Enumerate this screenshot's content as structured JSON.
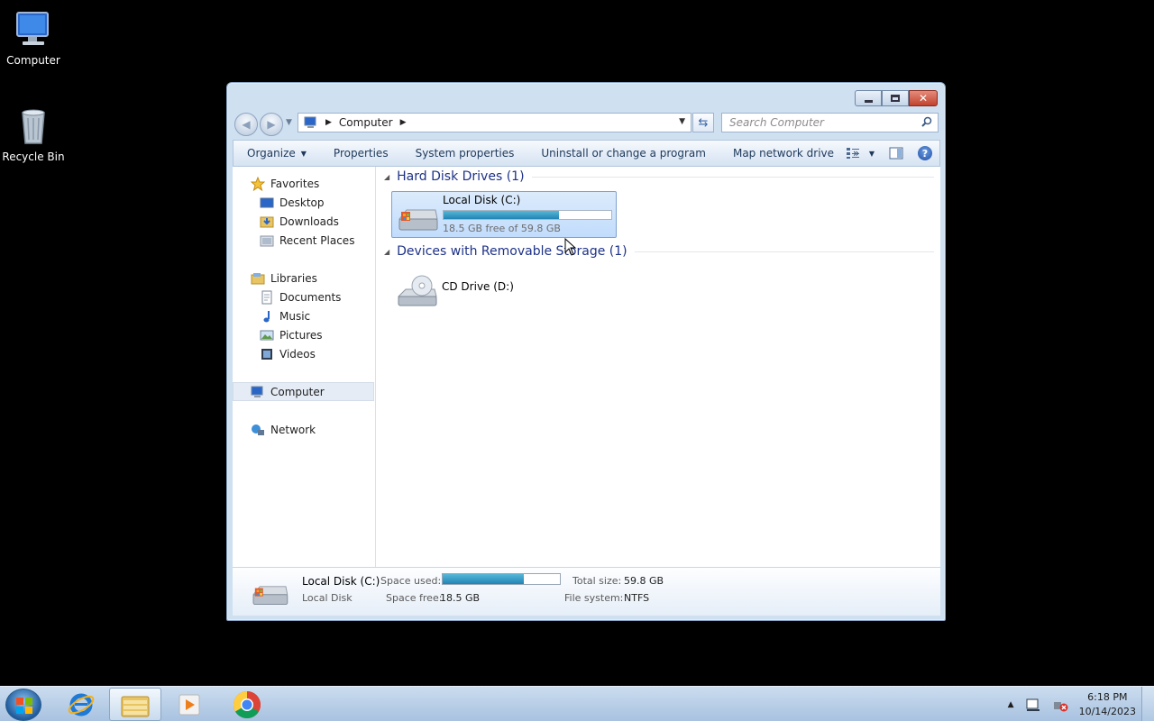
{
  "desktop": {
    "icons": [
      {
        "label": "Computer",
        "icon": "computer-icon"
      },
      {
        "label": "Recycle Bin",
        "icon": "recycle-bin-icon"
      }
    ]
  },
  "window": {
    "title": "",
    "nav": {
      "address_crumb": "Computer",
      "search_placeholder": "Search Computer"
    },
    "command_bar": {
      "organize": "Organize",
      "properties": "Properties",
      "system_properties": "System properties",
      "uninstall": "Uninstall or change a program",
      "map_drive": "Map network drive",
      "more": "»"
    },
    "nav_pane": {
      "favorites": "Favorites",
      "desktop": "Desktop",
      "downloads": "Downloads",
      "recent_places": "Recent Places",
      "libraries": "Libraries",
      "documents": "Documents",
      "music": "Music",
      "pictures": "Pictures",
      "videos": "Videos",
      "computer": "Computer",
      "network": "Network"
    },
    "content": {
      "group_hdd": "Hard Disk Drives (1)",
      "group_removable": "Devices with Removable Storage (1)",
      "local_disk": {
        "name": "Local Disk (C:)",
        "free_text": "18.5 GB free of 59.8 GB",
        "used_fraction": 0.69
      },
      "cd_drive": {
        "name": "CD Drive (D:)"
      }
    },
    "details": {
      "name": "Local Disk (C:)",
      "type": "Local Disk",
      "space_used_label": "Space used:",
      "space_free_label": "Space free:",
      "space_free_value": "18.5 GB",
      "total_size_label": "Total size:",
      "total_size_value": "59.8 GB",
      "file_system_label": "File system:",
      "file_system_value": "NTFS",
      "used_fraction": 0.69
    }
  },
  "taskbar": {
    "apps": [
      "internet-explorer-icon",
      "windows-explorer-icon",
      "media-player-icon",
      "chrome-icon"
    ],
    "clock_time": "6:18 PM",
    "clock_date": "10/14/2023"
  }
}
